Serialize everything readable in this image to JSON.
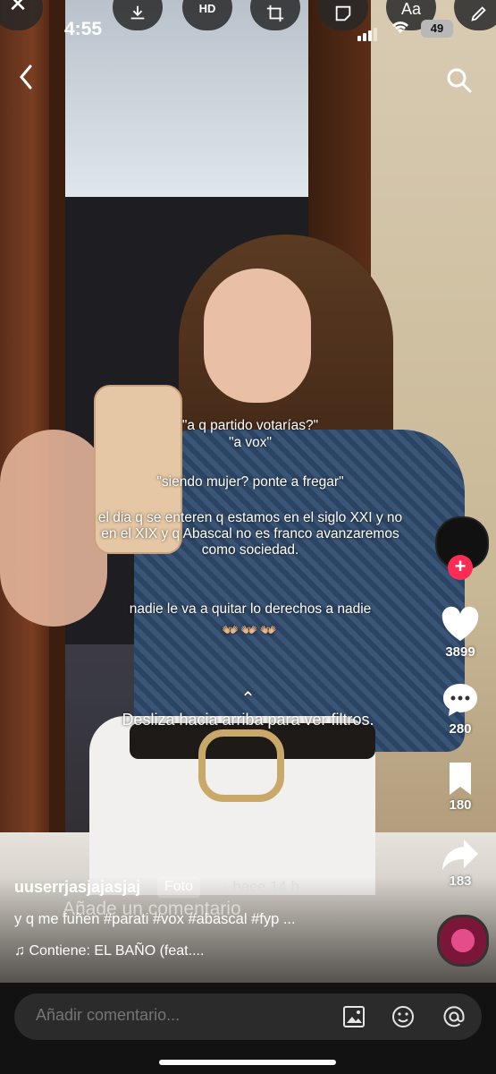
{
  "status_bar": {
    "time": "4:55",
    "battery": "49"
  },
  "editor_toolbar": {
    "close": "✕",
    "hd": "HD",
    "text": "Aa"
  },
  "overlay_text": {
    "line1": "\"a q partido votarías?\"",
    "line2": "\"a vox\"",
    "line3": "\"siendo mujer? ponte a fregar\"",
    "line4": "el dia q se enteren q estamos en el siglo XXI y no en el XIX y q Abascal no es franco avanzaremos como sociedad.",
    "line5": "nadie le va a quitar lo derechos a nadie",
    "emoji": "👐🏼👐🏼👐🏼"
  },
  "swipe_hint": {
    "arrow": "⌃",
    "text": "Desliza hacia arriba para ver filtros."
  },
  "actions": {
    "likes": "3899",
    "comments": "280",
    "saves": "180",
    "shares": "183"
  },
  "post": {
    "username": "uuserrjasjajasjaj",
    "badge": "Foto",
    "ago": "· hace 14 h",
    "caption": "y q me fuñen #parati #vox #abascal #fyp ...",
    "music_note": "♫",
    "music": "Contiene: EL BAÑO (feat....",
    "ghost_comment": "Añade un comentario"
  },
  "comment_bar": {
    "placeholder": "Añadir comentario..."
  },
  "colors": {
    "accent": "#fe2c55",
    "bar_bg": "#121212",
    "input_bg": "#2b2b2b"
  }
}
